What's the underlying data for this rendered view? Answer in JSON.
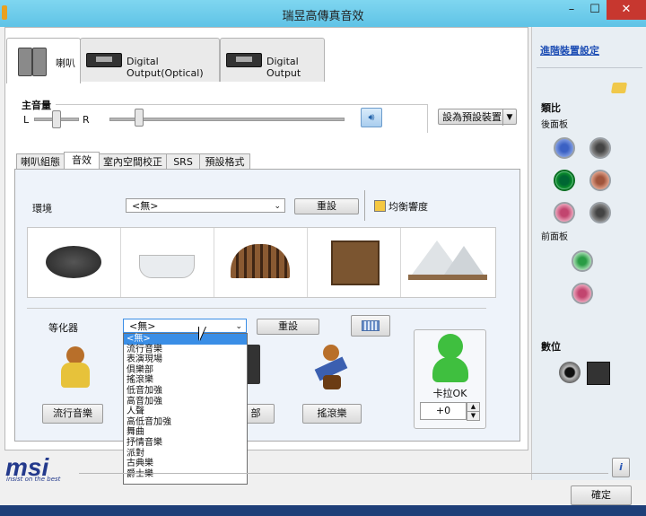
{
  "window": {
    "title": "瑞昱高傳真音效",
    "min": "–",
    "max": "☐",
    "close": "✕"
  },
  "device_tabs": [
    {
      "label": "喇叭"
    },
    {
      "label": "Digital Output(Optical)"
    },
    {
      "label": "Digital Output"
    }
  ],
  "master_volume": {
    "label": "主音量",
    "left": "L",
    "right": "R",
    "set_default": "設為預設裝置"
  },
  "sub_tabs": [
    "喇叭組態",
    "音效",
    "室內空間校正",
    "SRS",
    "預設格式"
  ],
  "environment": {
    "label": "環境",
    "value": "<無>",
    "reset": "重設",
    "balance_label": "均衡響度"
  },
  "equalizer": {
    "label": "等化器",
    "value": "<無>",
    "reset": "重設",
    "options": [
      "<無>",
      "流行音樂",
      "表演現場",
      "俱樂部",
      "搖滾樂",
      "低音加強",
      "高音加強",
      "人聲",
      "高低音加強",
      "舞曲",
      "抒情音樂",
      "派對",
      "古典樂",
      "爵士樂"
    ],
    "preset_buttons": [
      "流行音樂",
      "部",
      "搖滾樂"
    ],
    "karaoke_label": "卡拉OK",
    "karaoke_value": "+0"
  },
  "right_panel": {
    "advanced_link": "進階裝置設定",
    "analog_label": "類比",
    "back_panel": "後面板",
    "front_panel": "前面板",
    "digital_label": "數位",
    "info_icon": "i"
  },
  "ok_button": "確定",
  "brand": {
    "logo": "msi",
    "tagline": "insist on the best"
  },
  "colors": {
    "titlebar": "#5fc3e6",
    "close": "#c7372f",
    "selection": "#3a8ee6"
  }
}
